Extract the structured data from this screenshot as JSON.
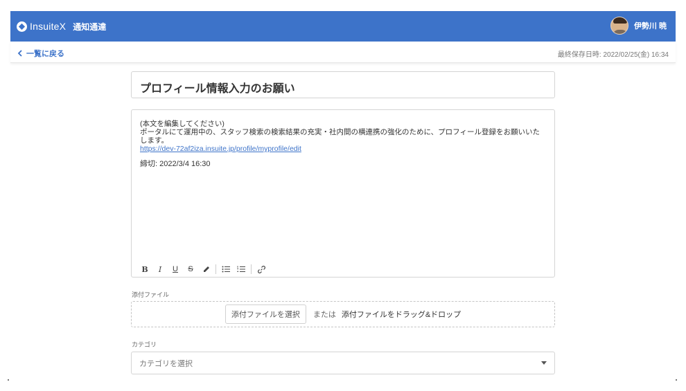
{
  "header": {
    "brand": "InsuiteX",
    "app_title": "通知通達",
    "user_name": "伊勢川 暁",
    "bar_color": "#3d73c9"
  },
  "subbar": {
    "back_label": "一覧に戻る",
    "last_saved": "最終保存日時: 2022/02/25(金) 16:34"
  },
  "form": {
    "title": "プロフィール情報入力のお願い",
    "body": {
      "line1": "(本文を編集してください)",
      "line2": "ポータルにて運用中の、スタッフ検索の検索結果の充実・社内間の横連携の強化のために、プロフィール登録をお願いいた",
      "line3": "します。",
      "link": "https://dev-72af2iza.insuite.jp/profile/myprofile/edit",
      "deadline": "締切: 2022/3/4 16:30"
    },
    "toolbar": [
      "B",
      "I",
      "U",
      "S"
    ],
    "attachment": {
      "label": "添付ファイル",
      "button": "添付ファイルを選択",
      "or": "または",
      "drop_text": "添付ファイルをドラッグ&ドロップ"
    },
    "category": {
      "label": "カテゴリ",
      "placeholder": "カテゴリを選択"
    }
  }
}
